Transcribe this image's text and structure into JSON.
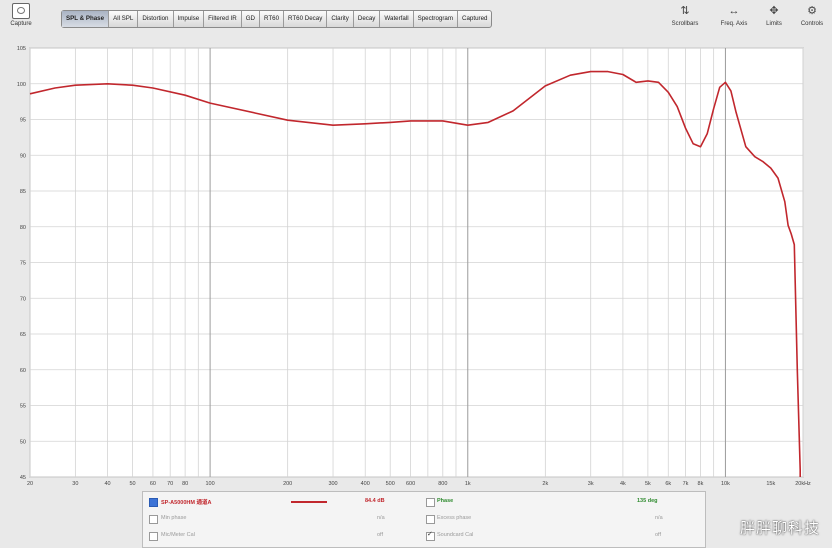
{
  "toolbar": {
    "capture_label": "Capture",
    "tabs": [
      "SPL & Phase",
      "All SPL",
      "Distortion",
      "Impulse",
      "Filtered IR",
      "GD",
      "RT60",
      "RT60 Decay",
      "Clarity",
      "Decay",
      "Waterfall",
      "Spectrogram",
      "Captured"
    ],
    "active_tab": 0,
    "tools": [
      {
        "label": "Scrollbars",
        "icon": "scrollbars-icon",
        "glyph": "⇅"
      },
      {
        "label": "Freq. Axis",
        "icon": "freq-axis-icon",
        "glyph": "↔"
      },
      {
        "label": "Limits",
        "icon": "limits-icon",
        "glyph": "✥"
      },
      {
        "label": "Controls",
        "icon": "controls-icon",
        "glyph": "⚙"
      }
    ]
  },
  "chart_data": {
    "type": "line",
    "title": "",
    "xlabel": "",
    "ylabel": "",
    "x_scale": "log",
    "xlim": [
      20,
      20000
    ],
    "ylim": [
      45,
      105
    ],
    "yticks": [
      "45",
      "50",
      "55",
      "60",
      "65",
      "70",
      "75",
      "80",
      "85",
      "90",
      "95",
      "100",
      "105"
    ],
    "xticks": [
      {
        "value": 20,
        "label": "20"
      },
      {
        "value": 30,
        "label": "30"
      },
      {
        "value": 40,
        "label": "40"
      },
      {
        "value": 50,
        "label": "50"
      },
      {
        "value": 60,
        "label": "60"
      },
      {
        "value": 70,
        "label": "70"
      },
      {
        "value": 80,
        "label": "80"
      },
      {
        "value": 100,
        "label": "100"
      },
      {
        "value": 200,
        "label": "200"
      },
      {
        "value": 300,
        "label": "300"
      },
      {
        "value": 400,
        "label": "400"
      },
      {
        "value": 500,
        "label": "500"
      },
      {
        "value": 600,
        "label": "600"
      },
      {
        "value": 800,
        "label": "800"
      },
      {
        "value": 1000,
        "label": "1k"
      },
      {
        "value": 2000,
        "label": "2k"
      },
      {
        "value": 3000,
        "label": "3k"
      },
      {
        "value": 4000,
        "label": "4k"
      },
      {
        "value": 5000,
        "label": "5k"
      },
      {
        "value": 6000,
        "label": "6k"
      },
      {
        "value": 7000,
        "label": "7k"
      },
      {
        "value": 8000,
        "label": "8k"
      },
      {
        "value": 10000,
        "label": "10k"
      },
      {
        "value": 15000,
        "label": "15k"
      },
      {
        "value": 20000,
        "label": "20kHz"
      }
    ],
    "grid": true,
    "series": [
      {
        "name": "SP-A5000HM 通道A",
        "color": "#c1272d",
        "x": [
          20,
          25,
          30,
          40,
          50,
          60,
          80,
          100,
          150,
          200,
          300,
          400,
          500,
          600,
          800,
          1000,
          1200,
          1500,
          2000,
          2500,
          3000,
          3500,
          4000,
          4500,
          5000,
          5500,
          6000,
          6500,
          7000,
          7500,
          8000,
          8500,
          9000,
          9500,
          10000,
          10500,
          11000,
          12000,
          13000,
          14000,
          15000,
          16000,
          17000,
          17500,
          18000,
          18500,
          19000,
          19500
        ],
        "y": [
          98.6,
          99.4,
          99.8,
          100.0,
          99.8,
          99.4,
          98.4,
          97.3,
          95.9,
          94.9,
          94.2,
          94.4,
          94.6,
          94.8,
          94.8,
          94.2,
          94.6,
          96.2,
          99.7,
          101.2,
          101.7,
          101.7,
          101.3,
          100.2,
          100.4,
          100.2,
          98.8,
          96.8,
          93.8,
          91.6,
          91.2,
          93.0,
          96.5,
          99.5,
          100.2,
          99.0,
          96.0,
          91.2,
          89.8,
          89.1,
          88.2,
          86.8,
          83.5,
          80.2,
          79.0,
          77.5,
          60.0,
          46.0
        ]
      }
    ]
  },
  "legend": {
    "rows": [
      [
        {
          "checkbox": "checked-blue",
          "label": "SP-A5000HM 通道A",
          "style": "red",
          "swatch": true,
          "value": "84.4 dB"
        },
        {
          "checkbox": "empty",
          "label": "Phase",
          "style": "green",
          "value": "135 deg"
        }
      ],
      [
        {
          "checkbox": "empty",
          "label": "Min phase",
          "style": "muted",
          "value": "n/a"
        },
        {
          "checkbox": "empty",
          "label": "Excess phase",
          "style": "muted",
          "value": "n/a"
        }
      ],
      [
        {
          "checkbox": "empty",
          "label": "Mic/Meter Cal",
          "style": "muted",
          "value": "off"
        },
        {
          "checkbox": "ticked",
          "label": "Soundcard Cal",
          "style": "muted",
          "value": "off"
        }
      ]
    ]
  },
  "watermark": "胖胖聊科技"
}
